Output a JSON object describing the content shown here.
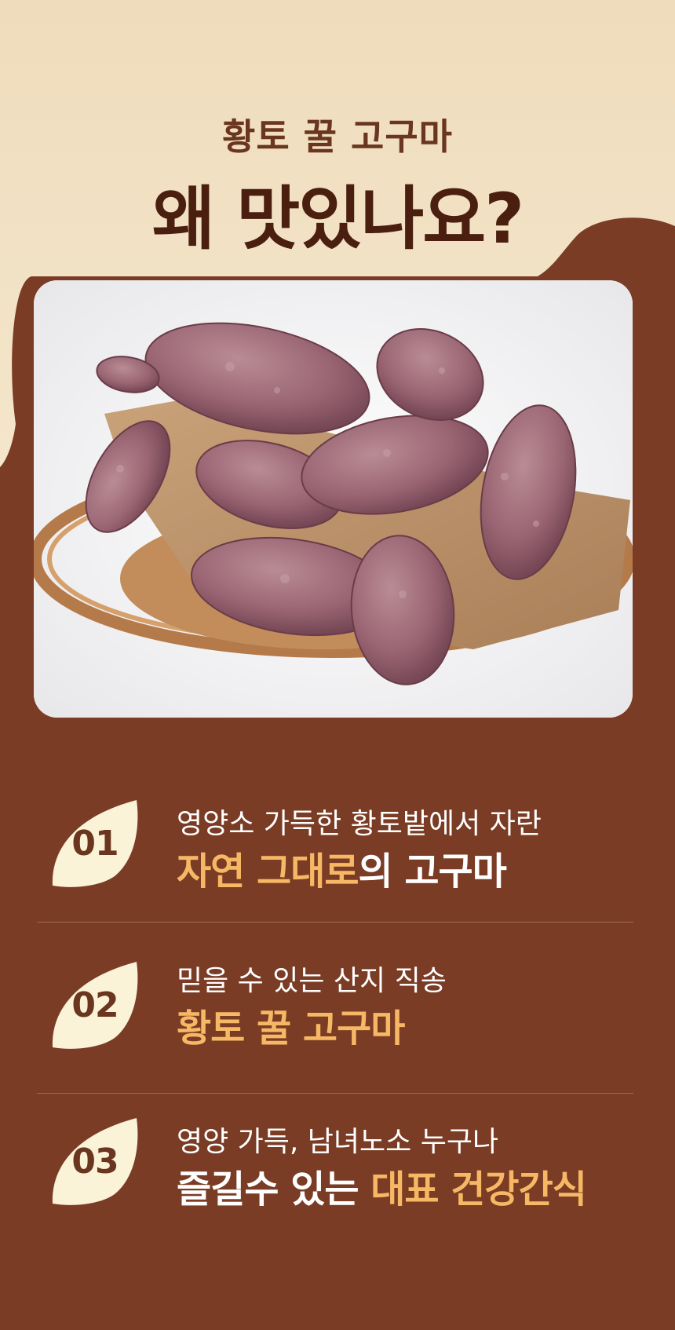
{
  "header": {
    "subtitle": "황토 꿀 고구마",
    "title": "왜 맛있나요?"
  },
  "photo": {
    "subject": "sweet-potatoes-in-basket"
  },
  "features": [
    {
      "number": "01",
      "line1": "영양소 가득한 황토밭에서 자란",
      "line2_highlight": "자연 그대로",
      "line2_rest": "의 고구마"
    },
    {
      "number": "02",
      "line1": "믿을 수 있는 산지 직송",
      "line2_highlight": "황토 꿀 고구마"
    },
    {
      "number": "03",
      "line1": "영양 가득, 남녀노소 누구나",
      "line2_white": "즐길수 있는 ",
      "line2_highlight": "대표 건강간식"
    }
  ],
  "colors": {
    "background_brown": "#7a3c24",
    "cream": "#f1dfbd",
    "highlight": "#f7b866",
    "title_dark": "#4a1f10",
    "badge": "#fbf3d8"
  }
}
